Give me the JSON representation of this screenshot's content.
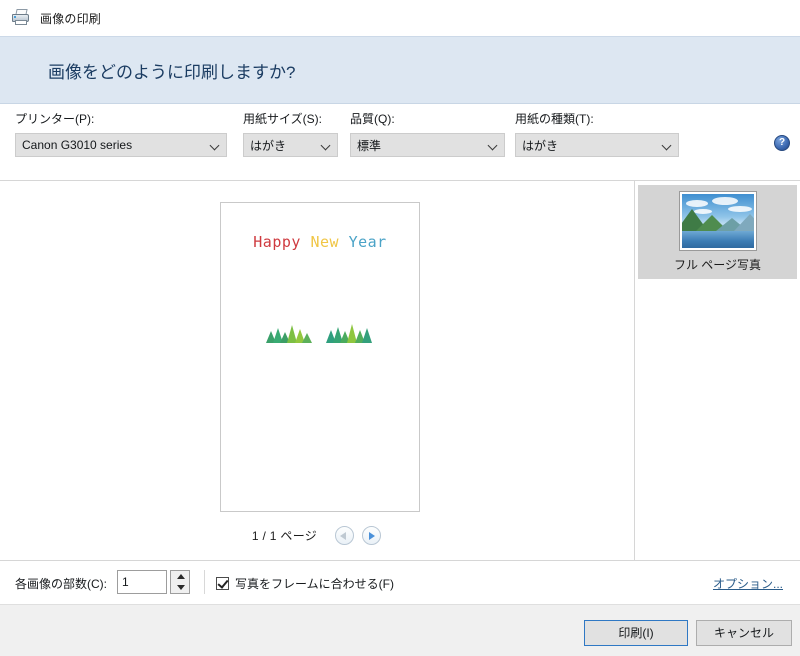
{
  "window": {
    "title": "画像の印刷",
    "icon": "printer-icon"
  },
  "header": {
    "title": "画像をどのように印刷しますか?"
  },
  "options": {
    "printer": {
      "label": "プリンター(P):",
      "value": "Canon G3010 series"
    },
    "paper_size": {
      "label": "用紙サイズ(S):",
      "value": "はがき"
    },
    "quality": {
      "label": "品質(Q):",
      "value": "標準"
    },
    "paper_type": {
      "label": "用紙の種類(T):",
      "value": "はがき"
    },
    "help_icon": "?"
  },
  "preview": {
    "greeting": {
      "word1": "Happy",
      "word2": "New",
      "word3": "Year",
      "color1": "#cf3a3f",
      "color2": "#f0c646",
      "color3": "#4ba3c7"
    },
    "page_indicator": "1 / 1 ページ",
    "prev_button": "previous-page-arrow",
    "next_button": "next-page-arrow"
  },
  "layouts": {
    "items": [
      {
        "caption": "フル ページ写真",
        "selected": true
      }
    ]
  },
  "bottom": {
    "copies_label": "各画像の部数(C):",
    "copies_value": "1",
    "fit_frame_label": "写真をフレームに合わせる(F)",
    "fit_frame_checked": true,
    "options_link": "オプション..."
  },
  "buttons": {
    "print": "印刷(I)",
    "cancel": "キャンセル"
  }
}
